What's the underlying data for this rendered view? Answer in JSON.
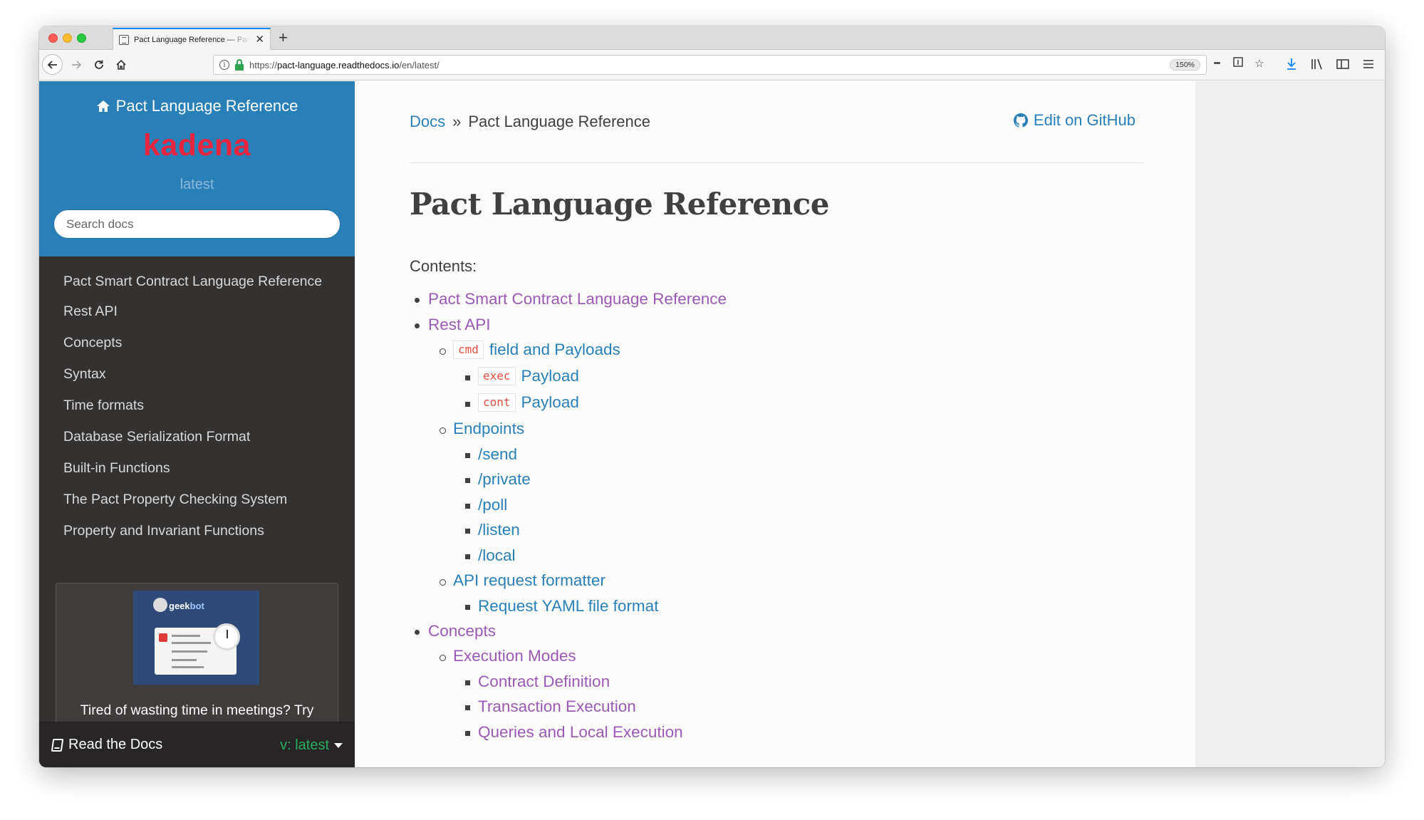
{
  "browser": {
    "tab_title": "Pact Language Reference — Pact Language Reference latest documentation",
    "url_prefix": "https://",
    "url_host": "pact-language.readthedocs.io",
    "url_path": "/en/latest/",
    "zoom": "150%",
    "page_actions_glyph": "•••"
  },
  "sidebar": {
    "project_title": "Pact Language Reference",
    "logo_text": "kadena",
    "version": "latest",
    "search_placeholder": "Search docs",
    "nav_items": [
      "Pact Smart Contract Language Reference",
      "Rest API",
      "Concepts",
      "Syntax",
      "Time formats",
      "Database Serialization Format",
      "Built-in Functions",
      "The Pact Property Checking System",
      "Property and Invariant Functions"
    ],
    "ad": {
      "brand_geek": "geek",
      "brand_bot": "bot",
      "text": "Tired of wasting time in meetings? Try"
    },
    "footer": {
      "label": "Read the Docs",
      "version_label": "v: latest"
    }
  },
  "content": {
    "breadcrumb": {
      "docs": "Docs",
      "separator": "»",
      "current": "Pact Language Reference"
    },
    "edit_link": "Edit on GitHub",
    "title": "Pact Language Reference",
    "contents_label": "Contents:",
    "toc": {
      "pact_ref": "Pact Smart Contract Language Reference",
      "rest_api": "Rest API",
      "cmd_code": "cmd",
      "cmd_text": "field and Payloads",
      "exec_code": "exec",
      "exec_text": "Payload",
      "cont_code": "cont",
      "cont_text": "Payload",
      "endpoints": "Endpoints",
      "send": "/send",
      "private": "/private",
      "poll": "/poll",
      "listen": "/listen",
      "local": "/local",
      "api_formatter": "API request formatter",
      "yaml_format": "Request YAML file format",
      "concepts": "Concepts",
      "execution_modes": "Execution Modes",
      "contract_definition": "Contract Definition",
      "transaction_execution": "Transaction Execution",
      "queries_local": "Queries and Local Execution"
    }
  },
  "colors": {
    "sidebar_header": "#2980b9",
    "sidebar_bg": "#343131",
    "link": "#2980b9",
    "visited_link": "#9b59b6",
    "code": "#e74c3c",
    "logo": "#e8253f",
    "version_switch": "#27ae60"
  }
}
